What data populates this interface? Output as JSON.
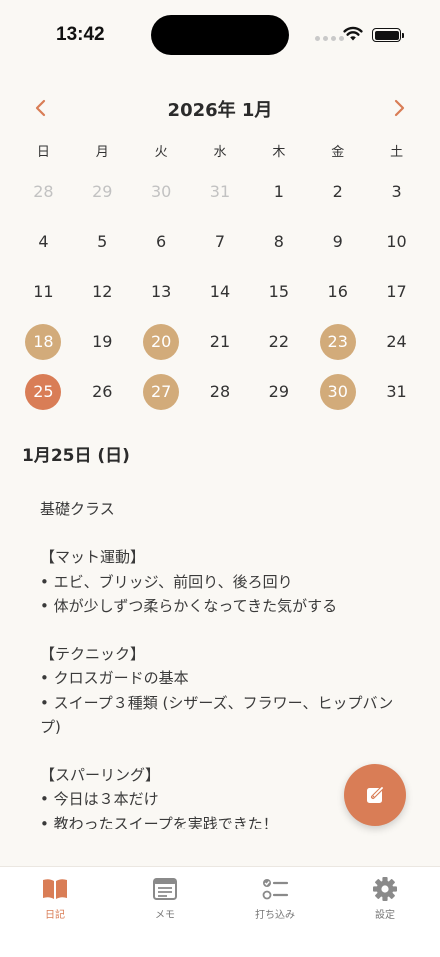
{
  "status": {
    "time": "13:42"
  },
  "calendar": {
    "month_label": "2026年 1月",
    "weekdays": [
      "日",
      "月",
      "火",
      "水",
      "木",
      "金",
      "土"
    ],
    "days": [
      {
        "d": "28",
        "state": "muted"
      },
      {
        "d": "29",
        "state": "muted"
      },
      {
        "d": "30",
        "state": "muted"
      },
      {
        "d": "31",
        "state": "muted"
      },
      {
        "d": "1",
        "state": ""
      },
      {
        "d": "2",
        "state": ""
      },
      {
        "d": "3",
        "state": ""
      },
      {
        "d": "4",
        "state": ""
      },
      {
        "d": "5",
        "state": ""
      },
      {
        "d": "6",
        "state": ""
      },
      {
        "d": "7",
        "state": ""
      },
      {
        "d": "8",
        "state": ""
      },
      {
        "d": "9",
        "state": ""
      },
      {
        "d": "10",
        "state": ""
      },
      {
        "d": "11",
        "state": ""
      },
      {
        "d": "12",
        "state": ""
      },
      {
        "d": "13",
        "state": ""
      },
      {
        "d": "14",
        "state": ""
      },
      {
        "d": "15",
        "state": ""
      },
      {
        "d": "16",
        "state": ""
      },
      {
        "d": "17",
        "state": ""
      },
      {
        "d": "18",
        "state": "entry"
      },
      {
        "d": "19",
        "state": ""
      },
      {
        "d": "20",
        "state": "entry"
      },
      {
        "d": "21",
        "state": ""
      },
      {
        "d": "22",
        "state": ""
      },
      {
        "d": "23",
        "state": "entry"
      },
      {
        "d": "24",
        "state": ""
      },
      {
        "d": "25",
        "state": "selected"
      },
      {
        "d": "26",
        "state": ""
      },
      {
        "d": "27",
        "state": "entry"
      },
      {
        "d": "28",
        "state": ""
      },
      {
        "d": "29",
        "state": ""
      },
      {
        "d": "30",
        "state": "entry"
      },
      {
        "d": "31",
        "state": ""
      }
    ]
  },
  "entry": {
    "date_heading": "1月25日 (日)",
    "lines": [
      "基礎クラス",
      "",
      "【マット運動】",
      "• エビ、ブリッジ、前回り、後ろ回り",
      "• 体が少しずつ柔らかくなってきた気がする",
      "",
      "【テクニック】",
      "• クロスガードの基本",
      "• スイープ３種類 (シザーズ、フラワー、ヒップバンプ)",
      "",
      "【スパーリング】",
      "• 今日は３本だけ",
      "• 教わったスイープを実践できた！"
    ]
  },
  "tabs": [
    {
      "label": "日記",
      "icon": "book-icon",
      "active": true
    },
    {
      "label": "メモ",
      "icon": "memo-icon",
      "active": false
    },
    {
      "label": "打ち込み",
      "icon": "checklist-icon",
      "active": false
    },
    {
      "label": "設定",
      "icon": "gear-icon",
      "active": false
    }
  ],
  "colors": {
    "accent": "#d97d56",
    "entry_day": "#d2ab7a",
    "background": "#faf8f4"
  }
}
